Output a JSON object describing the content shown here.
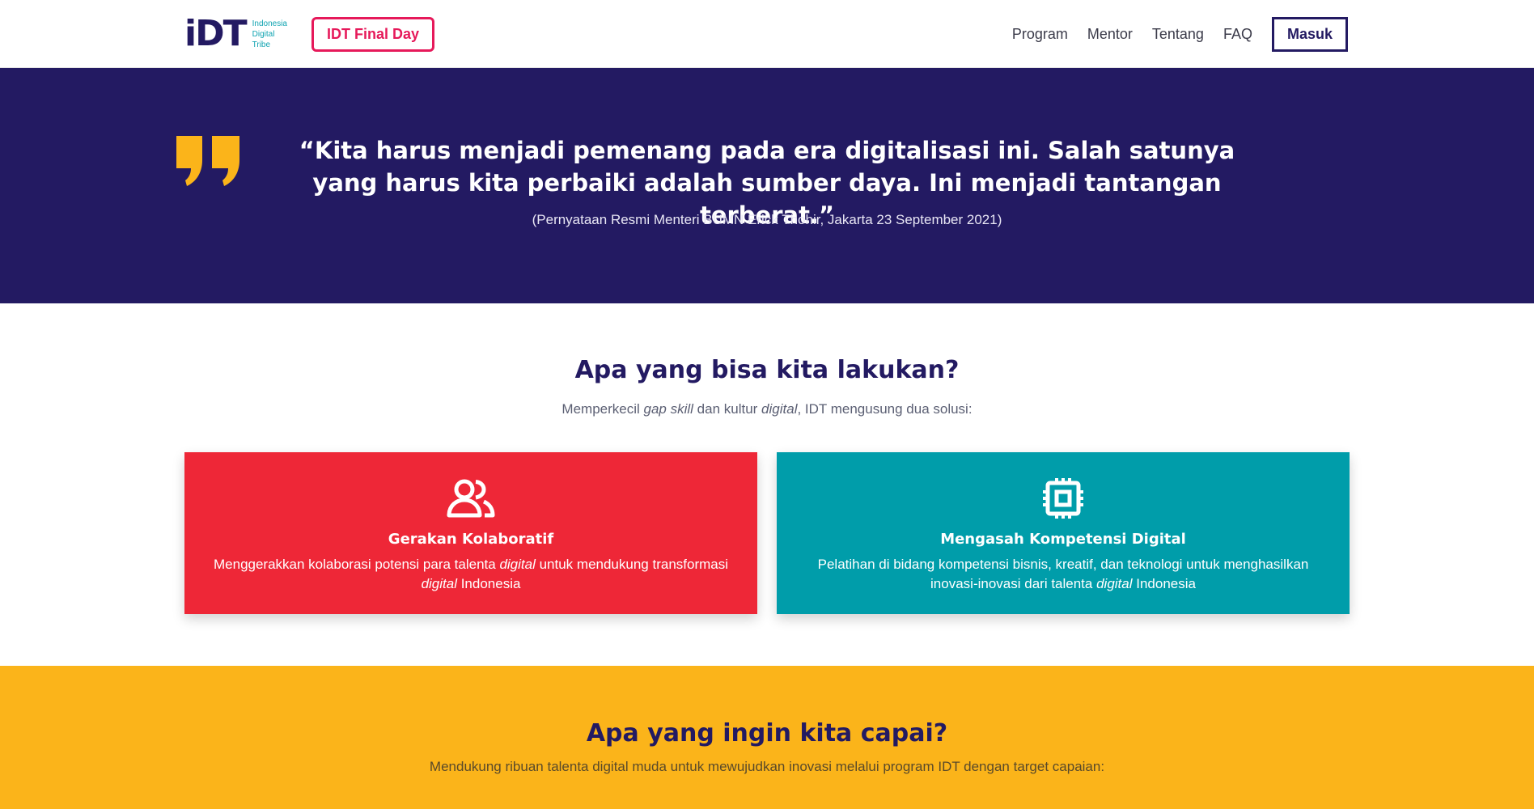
{
  "header": {
    "logo_text": "iDT",
    "logo_sub": [
      "Indonesia",
      "Digital",
      "Tribe"
    ],
    "final_day_label": "IDT Final Day",
    "nav": [
      "Program",
      "Mentor",
      "Tentang",
      "FAQ"
    ],
    "login_label": "Masuk"
  },
  "quote": {
    "text": "“Kita harus menjadi pemenang pada era digitalisasi ini. Salah satunya yang harus kita perbaiki adalah sumber daya. Ini menjadi tantangan terberat.”",
    "source": "(Pernyataan Resmi Menteri BUMN Erick Thohir, Jakarta 23 September 2021)"
  },
  "solutions": {
    "title": "Apa yang bisa kita lakukan?",
    "subtitle_parts": [
      "Memperkecil ",
      "gap skill",
      " dan kultur ",
      "digital",
      ", IDT mengusung dua solusi:"
    ],
    "cards": [
      {
        "icon": "users-icon",
        "title": "Gerakan Kolaboratif",
        "desc_parts": [
          "Menggerakkan kolaborasi potensi para talenta ",
          "digital",
          " untuk mendukung transformasi ",
          "digital",
          " Indonesia"
        ]
      },
      {
        "icon": "chip-icon",
        "title": "Mengasah Kompetensi Digital",
        "desc_parts": [
          "Pelatihan di bidang kompetensi bisnis, kreatif, dan teknologi untuk menghasilkan inovasi-inovasi dari talenta ",
          "digital",
          " Indonesia"
        ]
      }
    ]
  },
  "achievements": {
    "title": "Apa yang ingin kita capai?",
    "subtitle": "Mendukung ribuan talenta digital muda untuk mewujudkan inovasi melalui program IDT dengan target capaian:"
  },
  "colors": {
    "navy": "#231a62",
    "pink": "#e6195a",
    "red": "#ee2737",
    "teal": "#009daa",
    "yellow": "#fbb41a"
  }
}
